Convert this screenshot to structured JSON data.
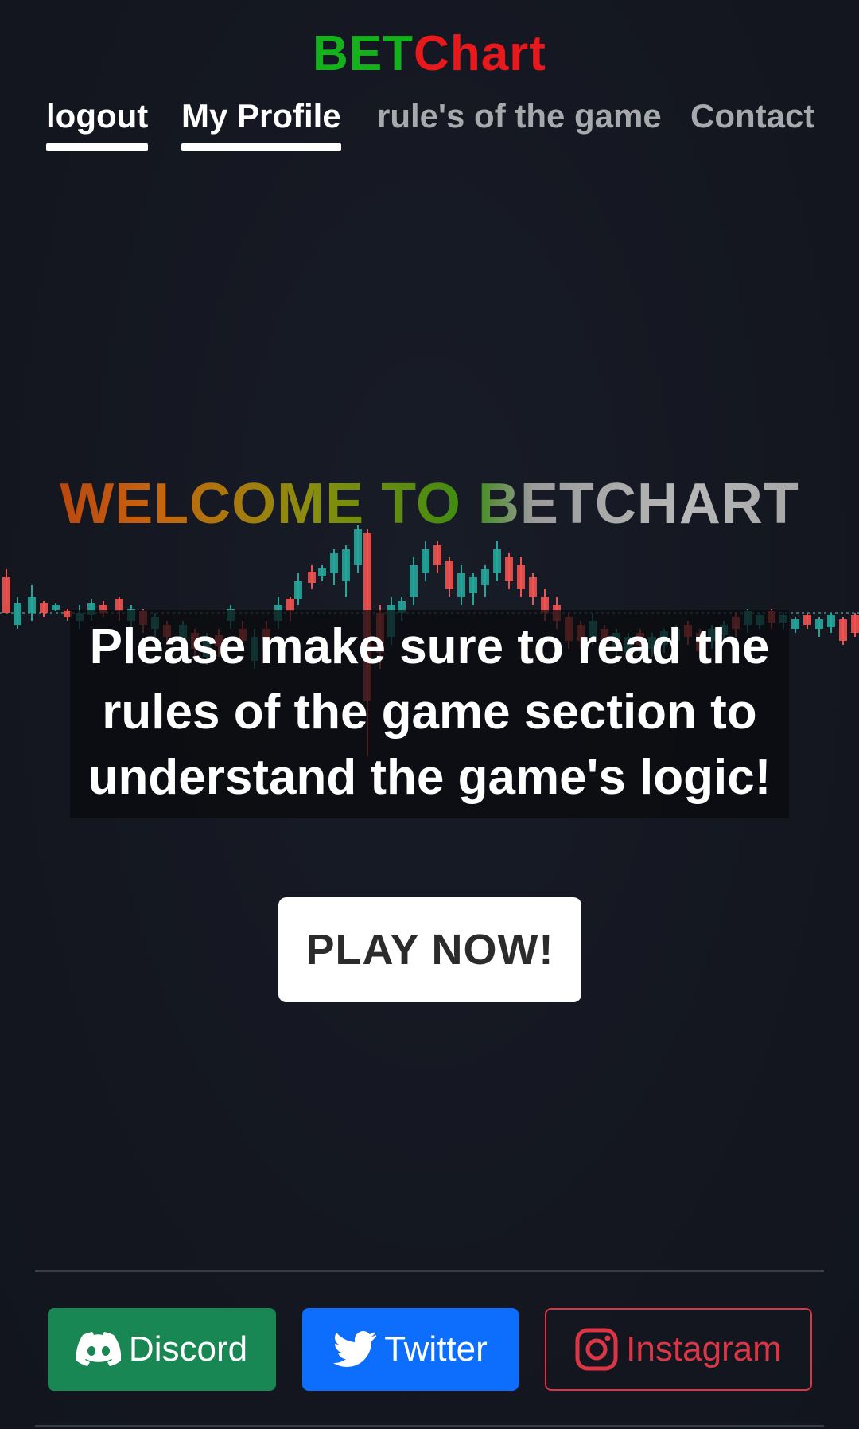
{
  "brand": {
    "part1": "BET",
    "part2": "Chart",
    "part1_color": "#14b21a",
    "part2_color": "#e8191d"
  },
  "nav": {
    "items": [
      {
        "label": "logout",
        "active": true
      },
      {
        "label": "My Profile",
        "active": true
      },
      {
        "label": "rule's of the game",
        "active": false
      },
      {
        "label": "Contact",
        "active": false
      }
    ]
  },
  "hero": {
    "welcome": "WELCOME TO BETCHART",
    "notice": "Please make sure to read the rules of the game section to understand the game's logic!",
    "play_label": "PLAY NOW!",
    "background_icon": "candlestick-chart-icon"
  },
  "footer": {
    "discord_label": "Discord",
    "twitter_label": "Twitter",
    "instagram_label": "Instagram",
    "discord_color": "#198754",
    "twitter_color": "#0d6efd",
    "instagram_color": "#dc3545"
  }
}
